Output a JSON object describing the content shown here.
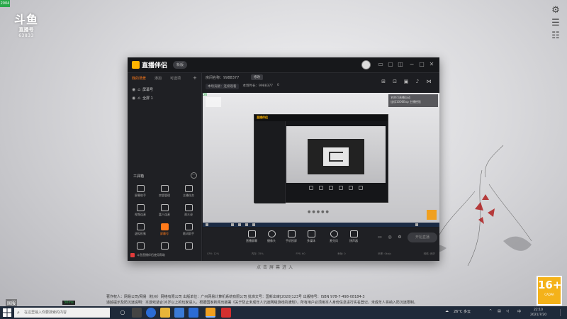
{
  "desktop": {
    "corner_tag": "2004",
    "logo": {
      "line1": "斗鱼",
      "line2": "直播号",
      "line3": "63833"
    },
    "click_enter": "点击屏幕进入",
    "rating": {
      "big": "16+",
      "small": "CADPA"
    },
    "guofu": "国服",
    "green_label": "30ms",
    "copyright": "著作权人：网易公司/网易（杭州）网络有限公司  出版单位：广州网易计算机系统有限公司  批准文号：国新出审[2020]123号  出版物号：ISBN 978-7-498-08184-3\n适龄提示及防沉迷说明：本游戏适合16岁以上的玩家进入。根据国家新闻出版署《关于防止未成年人沉迷网络游戏的通知》，所有用户必须用本人身份信息进行实名登记，未成年人将纳入防沉迷限制。"
  },
  "app": {
    "title": "直播伴侣",
    "version_pill": "新版",
    "tabs": [
      {
        "label": "我的场景",
        "active": true
      },
      {
        "label": "添加",
        "active": false
      },
      {
        "label": "可选项",
        "active": false
      }
    ],
    "scenes": [
      {
        "label": "屏幕号"
      },
      {
        "label": "全屏 1"
      }
    ],
    "tools_title": "工具箱",
    "tools_more": "···",
    "tools": [
      {
        "label": "屏幕助手"
      },
      {
        "label": "房管管理"
      },
      {
        "label": "主播任务"
      },
      {
        "label": "视频连麦"
      },
      {
        "label": "嘉人连麦"
      },
      {
        "label": "观众录"
      },
      {
        "label": "虚拟形象"
      },
      {
        "label": "屏幕号"
      },
      {
        "label": "歌词助手"
      },
      {
        "label": ""
      },
      {
        "label": ""
      },
      {
        "label": ""
      }
    ],
    "notice": "斗鱼直播伴侣使用帮助",
    "room_info": "房间名称：9988377",
    "room_btn": "修改",
    "sub_info": [
      {
        "label": "本场贡献：连续观看"
      },
      {
        "label": "本场时长：9988377"
      },
      {
        "label": "0"
      }
    ],
    "preview": {
      "label": "36",
      "badge_line1": "名称可直播自动",
      "badge_line2": "连续1000Exp 主播经验"
    },
    "nested_brand": "直播伴侣",
    "controls": [
      {
        "label": "直播屏幕"
      },
      {
        "label": "摄像头"
      },
      {
        "label": "手机投屏"
      },
      {
        "label": "多媒体"
      },
      {
        "label": "麦克风"
      },
      {
        "label": "扬声器"
      }
    ],
    "start_button": "开始直播",
    "status": [
      "CPU: 12%",
      "内存: 35%",
      "FPS: 60",
      "丢帧: 0",
      "码率: 0kb/s",
      "网络: 良好"
    ]
  },
  "taskbar": {
    "search_placeholder": "在这里输入你要搜索的内容",
    "weather": "26°C 多云",
    "ime": "中",
    "time": "22:10",
    "date": "2021/7/20"
  }
}
